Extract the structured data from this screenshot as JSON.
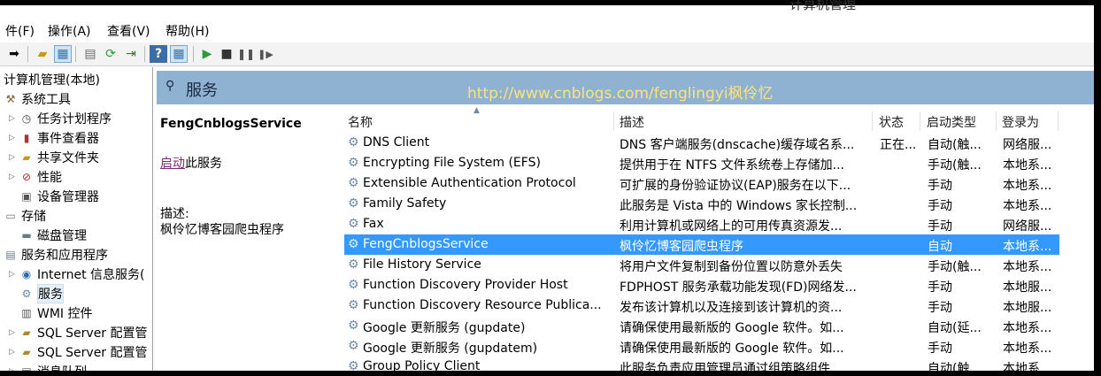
{
  "window": {
    "title": "计算机管理"
  },
  "menu": [
    "件(F)",
    "操作(A)",
    "查看(V)",
    "帮助(H)"
  ],
  "tree": {
    "items": [
      {
        "label": "计算机管理(本地)",
        "icon": "computer-icon"
      },
      {
        "label": "系统工具",
        "icon": "tools-icon"
      },
      {
        "label": "任务计划程序",
        "icon": "clock-icon"
      },
      {
        "label": "事件查看器",
        "icon": "event-viewer-icon"
      },
      {
        "label": "共享文件夹",
        "icon": "shared-folder-icon"
      },
      {
        "label": "性能",
        "icon": "performance-icon"
      },
      {
        "label": "设备管理器",
        "icon": "device-manager-icon"
      },
      {
        "label": "存储",
        "icon": "storage-icon"
      },
      {
        "label": "磁盘管理",
        "icon": "disk-icon"
      },
      {
        "label": "服务和应用程序",
        "icon": "services-apps-icon"
      },
      {
        "label": "Internet 信息服务(",
        "icon": "iis-icon"
      },
      {
        "label": "服务",
        "icon": "services-gear-icon"
      },
      {
        "label": "WMI 控件",
        "icon": "wmi-icon"
      },
      {
        "label": "SQL Server 配置管",
        "icon": "sql-icon"
      },
      {
        "label": "SQL Server 配置管",
        "icon": "sql-icon"
      },
      {
        "label": "消息队列",
        "icon": "queue-icon"
      }
    ]
  },
  "pane": {
    "title": "服务",
    "watermark": "http://www.cnblogs.com/fenglingyi枫伶忆"
  },
  "detail": {
    "service_name": "FengCnblogsService",
    "start_link": "启动",
    "start_suffix": "此服务",
    "desc_label": "描述:",
    "desc_text": "枫伶忆博客园爬虫程序"
  },
  "columns": {
    "name": "名称",
    "description": "描述",
    "status": "状态",
    "startup": "启动类型",
    "logon": "登录为"
  },
  "services": [
    {
      "name": "DNS Client",
      "description": "DNS 客户端服务(dnscache)缓存域名系...",
      "status": "正在...",
      "startup": "自动(触...",
      "logon": "网络服..."
    },
    {
      "name": "Encrypting File System (EFS)",
      "description": "提供用于在 NTFS 文件系统卷上存储加...",
      "status": "",
      "startup": "手动(触...",
      "logon": "本地系..."
    },
    {
      "name": "Extensible Authentication Protocol",
      "description": "可扩展的身份验证协议(EAP)服务在以下...",
      "status": "",
      "startup": "手动",
      "logon": "本地系..."
    },
    {
      "name": "Family Safety",
      "description": "此服务是 Vista 中的 Windows 家长控制...",
      "status": "",
      "startup": "手动",
      "logon": "本地系..."
    },
    {
      "name": "Fax",
      "description": "利用计算机或网络上的可用传真资源发...",
      "status": "",
      "startup": "手动",
      "logon": "网络服..."
    },
    {
      "name": "FengCnblogsService",
      "description": "枫伶忆博客园爬虫程序",
      "status": "",
      "startup": "自动",
      "logon": "本地系..."
    },
    {
      "name": "File History Service",
      "description": "将用户文件复制到备份位置以防意外丢失",
      "status": "",
      "startup": "手动(触...",
      "logon": "本地系..."
    },
    {
      "name": "Function Discovery Provider Host",
      "description": "FDPHOST 服务承载功能发现(FD)网络发...",
      "status": "",
      "startup": "手动",
      "logon": "本地服..."
    },
    {
      "name": "Function Discovery Resource Publica...",
      "description": "发布该计算机以及连接到该计算机的资...",
      "status": "",
      "startup": "手动",
      "logon": "本地服..."
    },
    {
      "name": "Google 更新服务 (gupdate)",
      "description": "请确保使用最新版的 Google 软件。如...",
      "status": "",
      "startup": "自动(延...",
      "logon": "本地系..."
    },
    {
      "name": "Google 更新服务 (gupdatem)",
      "description": "请确保使用最新版的 Google 软件。如...",
      "status": "",
      "startup": "手动",
      "logon": "本地系..."
    },
    {
      "name": "Group Policy Client",
      "description": "此服务负责应用管理员通过组策略组件...",
      "status": "",
      "startup": "自动(触...",
      "logon": "本地系..."
    }
  ],
  "selected_service": "FengCnblogsService",
  "colors": {
    "selection": "#3399ff",
    "header_band": "#8fb2d2",
    "watermark": "#ffe27a"
  }
}
